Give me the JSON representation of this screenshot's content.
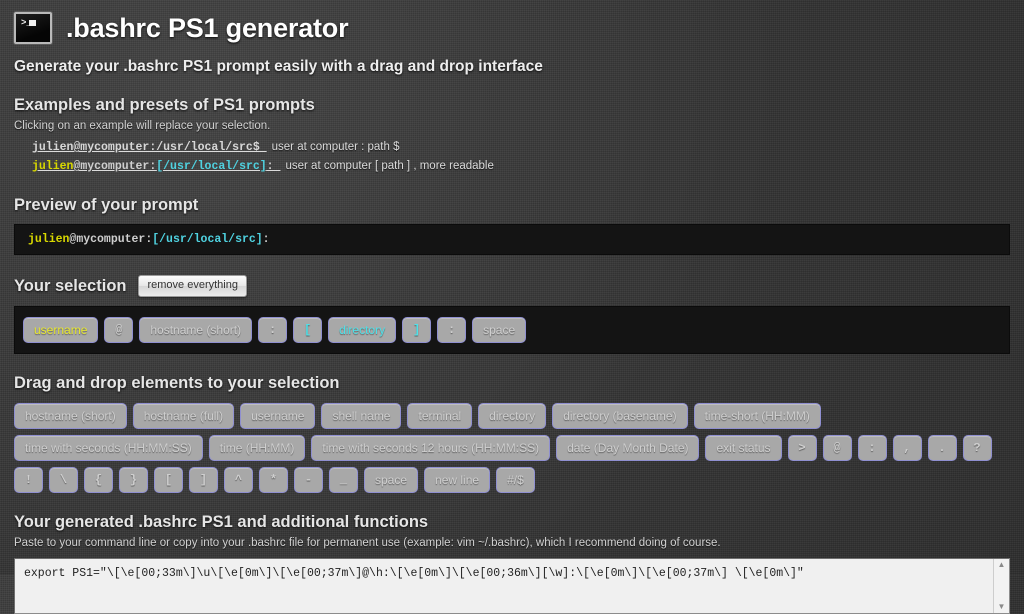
{
  "header": {
    "icon": "terminal-icon",
    "title": ".bashrc PS1 generator",
    "tagline": "Generate your .bashrc PS1 prompt easily with a drag and drop interface"
  },
  "examples": {
    "heading": "Examples and presets of PS1 prompts",
    "hint": "Clicking on an example will replace your selection.",
    "items": [
      {
        "parts": [
          {
            "text": "julien@mycomputer:/usr/local/src$ ",
            "color": "#d8d8d8"
          }
        ],
        "description": "user at computer : path $"
      },
      {
        "parts": [
          {
            "text": "julien",
            "color": "#d8d800"
          },
          {
            "text": "@mycomputer:",
            "color": "#cfcfcf"
          },
          {
            "text": "[/usr/local/src]",
            "color": "#4fd2e0"
          },
          {
            "text": ": ",
            "color": "#cfcfcf"
          }
        ],
        "description": "user at computer [ path ] , more readable"
      }
    ]
  },
  "preview": {
    "heading": "Preview of your prompt",
    "parts": [
      {
        "text": "julien",
        "color": "#d8d800"
      },
      {
        "text": "@mycomputer:",
        "color": "#cfcfcf"
      },
      {
        "text": "[/usr/local/src]",
        "color": "#4fd2e0"
      },
      {
        "text": ":",
        "color": "#cfcfcf"
      }
    ]
  },
  "selection": {
    "heading": "Your selection",
    "remove_all_label": "remove everything",
    "tokens": [
      {
        "label": "username",
        "style": "t-yellow",
        "sym": false
      },
      {
        "label": "@",
        "style": "t-dim",
        "sym": true
      },
      {
        "label": "hostname (short)",
        "style": "t-dim",
        "sym": false
      },
      {
        "label": ":",
        "style": "t-dim",
        "sym": true
      },
      {
        "label": "[",
        "style": "t-cyan",
        "sym": true
      },
      {
        "label": "directory",
        "style": "t-cyan",
        "sym": false
      },
      {
        "label": "]",
        "style": "t-cyan",
        "sym": true
      },
      {
        "label": ":",
        "style": "t-dim",
        "sym": true
      },
      {
        "label": "space",
        "style": "t-dim",
        "sym": false
      }
    ]
  },
  "palette": {
    "heading": "Drag and drop elements to your selection",
    "tokens": [
      {
        "label": "hostname (short)",
        "sym": false
      },
      {
        "label": "hostname (full)",
        "sym": false
      },
      {
        "label": "username",
        "sym": false
      },
      {
        "label": "shell name",
        "sym": false
      },
      {
        "label": "terminal",
        "sym": false
      },
      {
        "label": "directory",
        "sym": false
      },
      {
        "label": "directory (basename)",
        "sym": false
      },
      {
        "label": "time-short (HH:MM)",
        "sym": false
      },
      {
        "label": "time with seconds (HH:MM:SS)",
        "sym": false
      },
      {
        "label": "time (HH:MM)",
        "sym": false
      },
      {
        "label": "time with seconds 12 hours (HH:MM:SS)",
        "sym": false
      },
      {
        "label": "date (Day Month Date)",
        "sym": false
      },
      {
        "label": "exit status",
        "sym": false
      },
      {
        "label": ">",
        "sym": true
      },
      {
        "label": "@",
        "sym": true
      },
      {
        "label": ":",
        "sym": true
      },
      {
        "label": ",",
        "sym": true
      },
      {
        "label": ".",
        "sym": true
      },
      {
        "label": "?",
        "sym": true
      },
      {
        "label": "!",
        "sym": true
      },
      {
        "label": "\\",
        "sym": true
      },
      {
        "label": "{",
        "sym": true
      },
      {
        "label": "}",
        "sym": true
      },
      {
        "label": "[",
        "sym": true
      },
      {
        "label": "]",
        "sym": true
      },
      {
        "label": "^",
        "sym": true
      },
      {
        "label": "*",
        "sym": true
      },
      {
        "label": "-",
        "sym": true
      },
      {
        "label": "_",
        "sym": true
      },
      {
        "label": "space",
        "sym": false
      },
      {
        "label": "new line",
        "sym": false
      },
      {
        "label": "#/$",
        "sym": false
      }
    ]
  },
  "output": {
    "heading": "Your generated .bashrc PS1 and additional functions",
    "hint": "Paste to your command line or copy into your .bashrc file for permanent use (example: vim ~/.bashrc), which I recommend doing of course.",
    "value": "export PS1=\"\\[\\e[00;33m\\]\\u\\[\\e[0m\\]\\[\\e[00;37m\\]@\\h:\\[\\e[0m\\]\\[\\e[00;36m\\][\\w]:\\[\\e[0m\\]\\[\\e[00;37m\\] \\[\\e[0m\\]\"",
    "scroll_up_icon": "chevron-up-icon",
    "scroll_down_icon": "chevron-down-icon"
  },
  "colors": {
    "page_bg": "#3a3a3a",
    "panel_bg": "#141414",
    "token_bg": "#a8a8a8",
    "token_border": "#8f8fd0",
    "accent_yellow": "#d8d800",
    "accent_cyan": "#4fd2e0"
  }
}
